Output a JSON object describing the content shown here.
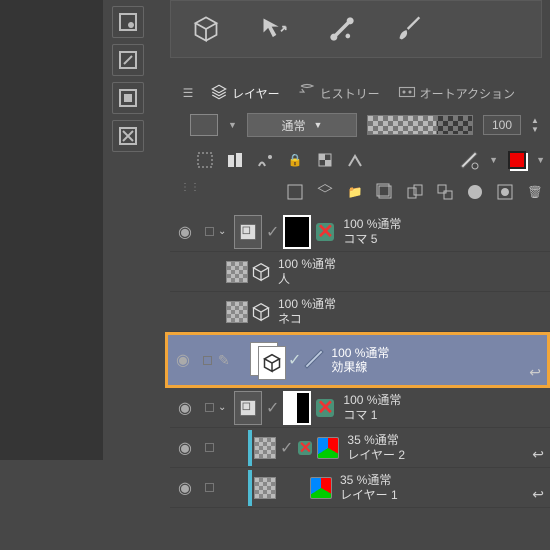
{
  "tabs": {
    "layer": "レイヤー",
    "history": "ヒストリー",
    "autoaction": "オートアクション"
  },
  "blend": {
    "mode": "通常",
    "opacity": "100"
  },
  "layers": [
    {
      "opacity_mode": "100 %通常",
      "name": "コマ 5"
    },
    {
      "opacity_mode": "100 %通常",
      "name": "人"
    },
    {
      "opacity_mode": "100 %通常",
      "name": "ネコ"
    },
    {
      "opacity_mode": "100 %通常",
      "name": "効果線"
    },
    {
      "opacity_mode": "100 %通常",
      "name": "コマ 1"
    },
    {
      "opacity_mode": "35 %通常",
      "name": "レイヤー 2"
    },
    {
      "opacity_mode": "35 %通常",
      "name": "レイヤー 1"
    }
  ]
}
